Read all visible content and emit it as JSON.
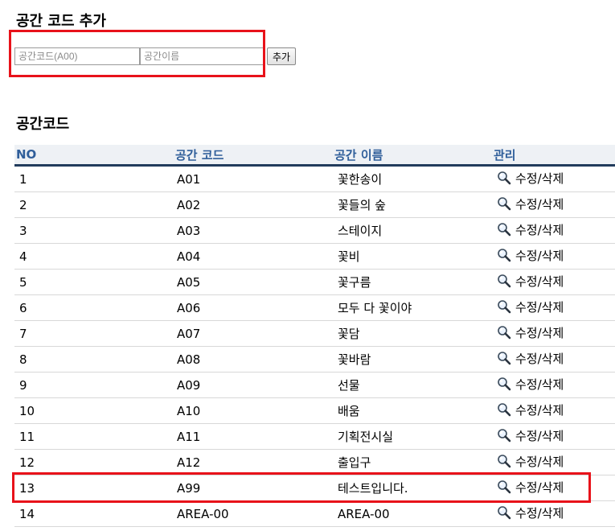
{
  "add_section": {
    "title": "공간 코드 추가",
    "code_placeholder": "공간코드(A00)",
    "name_placeholder": "공간이름",
    "add_label": "추가"
  },
  "list_section": {
    "title": "공간코드",
    "columns": [
      "NO",
      "공간 코드",
      "공간 이름",
      "관리"
    ],
    "rows": [
      {
        "no": "1",
        "code": "A01",
        "name": "꽃한송이",
        "action": "수정/삭제"
      },
      {
        "no": "2",
        "code": "A02",
        "name": "꽃들의 숲",
        "action": "수정/삭제"
      },
      {
        "no": "3",
        "code": "A03",
        "name": "스테이지",
        "action": "수정/삭제"
      },
      {
        "no": "4",
        "code": "A04",
        "name": "꽃비",
        "action": "수정/삭제"
      },
      {
        "no": "5",
        "code": "A05",
        "name": "꽃구름",
        "action": "수정/삭제"
      },
      {
        "no": "6",
        "code": "A06",
        "name": "모두 다 꽃이야",
        "action": "수정/삭제"
      },
      {
        "no": "7",
        "code": "A07",
        "name": "꽃담",
        "action": "수정/삭제"
      },
      {
        "no": "8",
        "code": "A08",
        "name": "꽃바람",
        "action": "수정/삭제"
      },
      {
        "no": "9",
        "code": "A09",
        "name": "선물",
        "action": "수정/삭제"
      },
      {
        "no": "10",
        "code": "A10",
        "name": "배움",
        "action": "수정/삭제"
      },
      {
        "no": "11",
        "code": "A11",
        "name": "기획전시실",
        "action": "수정/삭제"
      },
      {
        "no": "12",
        "code": "A12",
        "name": "출입구",
        "action": "수정/삭제"
      },
      {
        "no": "13",
        "code": "A99",
        "name": "테스트입니다.",
        "action": "수정/삭제"
      },
      {
        "no": "14",
        "code": "AREA-00",
        "name": "AREA-00",
        "action": "수정/삭제"
      }
    ]
  },
  "colors": {
    "highlight": "#e8121a",
    "header_text": "#2f5e9a",
    "header_rule": "#223c5c"
  },
  "icons": {
    "row_action": "search-icon"
  }
}
